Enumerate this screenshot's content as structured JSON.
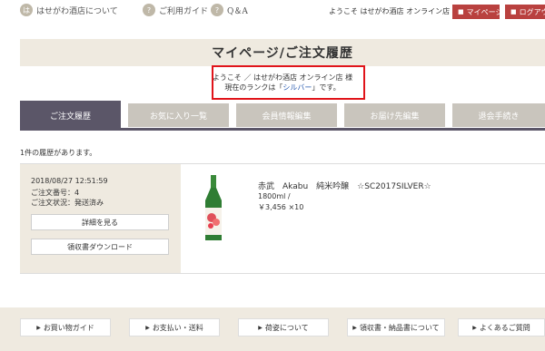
{
  "nav": {
    "about": {
      "icon_glyph": "は",
      "label": "はせがわ酒店について"
    },
    "guide": {
      "icon_glyph": "?",
      "label": "ご利用ガイド"
    },
    "qa": {
      "icon_glyph": "?",
      "label": "Q＆A"
    },
    "welcome": "ようこそ はせがわ酒店 オンライン店 様",
    "mypage_button": "マイページ",
    "logout_button": "ログアウト"
  },
  "page": {
    "title": "マイページ/ご注文履歴",
    "greeting_line1": "ようこそ ／ はせがわ酒店 オンライン店 様",
    "rank_prefix": "現在のランクは「",
    "rank_value": "シルバー",
    "rank_suffix": "」です。"
  },
  "tabs": [
    {
      "label": "ご注文履歴",
      "active": true
    },
    {
      "label": "お気に入り一覧",
      "active": false
    },
    {
      "label": "会員情報編集",
      "active": false
    },
    {
      "label": "お届け先編集",
      "active": false
    },
    {
      "label": "退会手続き",
      "active": false
    }
  ],
  "history_count": "1件の履歴があります。",
  "order": {
    "datetime": "2018/08/27 12:51:59",
    "number": "ご注文番号：4",
    "status": "ご注文状況：発送済み",
    "detail_button": "詳細を見る",
    "receipt_button": "領収書ダウンロード",
    "product_name": "赤武　Akabu　純米吟醸　☆SC2017SILVER☆",
    "volume": "1800ml /",
    "price_qty": "￥3,456 ×10"
  },
  "footer": [
    "お買い物ガイド",
    "お支払い・送料",
    "荷姿について",
    "領収書・納品書について",
    "よくあるご質問"
  ],
  "colors": {
    "accent_red": "#b9413f",
    "tab_active": "#5b5668",
    "tab_inactive": "#c9c5bd",
    "beige": "#efeae0",
    "highlight_box": "#e0141a",
    "rank_link": "#2a5bb0"
  }
}
